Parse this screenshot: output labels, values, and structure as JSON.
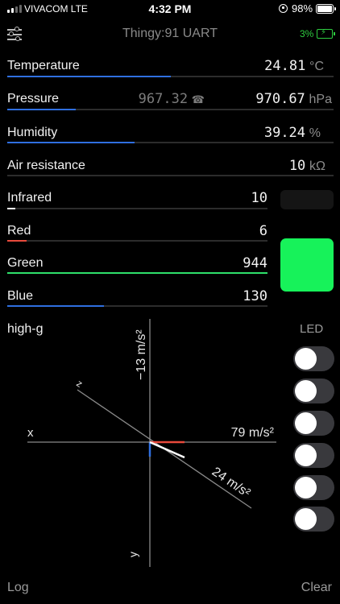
{
  "status_bar": {
    "carrier": "VIVACOM  LTE",
    "time": "4:32 PM",
    "battery": "98%"
  },
  "header": {
    "title": "Thingy:91 UART",
    "device_battery": "3%"
  },
  "colors": {
    "accent_blue": "#2f6fe0",
    "red": "#e84a3c",
    "green": "#2ee06a",
    "swatch_color": "#17f25a"
  },
  "sensors": {
    "temperature": {
      "label": "Temperature",
      "value": "24.81",
      "unit": "°C",
      "level": 0.5
    },
    "pressure": {
      "label": "Pressure",
      "secondary_value": "967.32",
      "value": "970.67",
      "unit": "hPa",
      "level": 0.21
    },
    "humidity": {
      "label": "Humidity",
      "value": "39.24",
      "unit": "%",
      "level": 0.39
    },
    "air_resistance": {
      "label": "Air resistance",
      "value": "10",
      "unit": "kΩ",
      "level": 0
    },
    "infrared": {
      "label": "Infrared",
      "value": "10",
      "level": 0.01
    },
    "red": {
      "label": "Red",
      "value": "6",
      "level": 0.01
    },
    "green": {
      "label": "Green",
      "value": "944",
      "level": 1.0
    },
    "blue": {
      "label": "Blue",
      "value": "130",
      "level": 0.37
    }
  },
  "accelerometer": {
    "title": "high-g",
    "x_label": "x",
    "y_label": "y",
    "z_label": "z",
    "x_value": "79 m/s²",
    "y_value": "−13 m/s²",
    "z_value": "24 m/s²"
  },
  "led": {
    "label": "LED",
    "toggles": [
      false,
      false,
      false,
      false,
      false,
      false
    ]
  },
  "footer": {
    "log": "Log",
    "clear": "Clear"
  }
}
